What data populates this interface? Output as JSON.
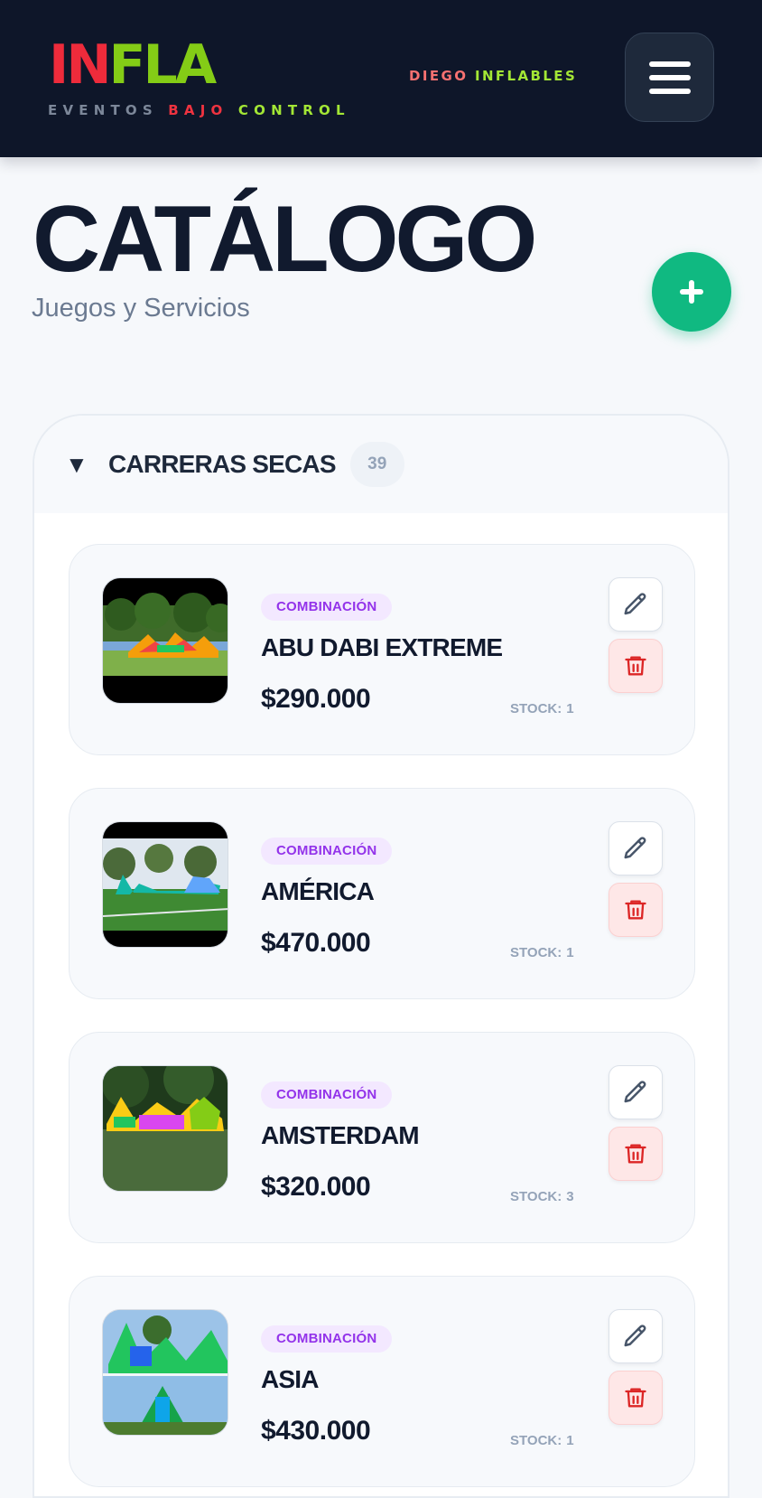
{
  "header": {
    "logo_in": "IN",
    "logo_fla": "FLA",
    "tagline_part1": "EVENTOS",
    "tagline_part2": "BAJO",
    "tagline_part3": "CONTROL",
    "user_first": "DIEGO",
    "user_second": "INFLABLES",
    "menu_icon": "hamburger-menu-icon"
  },
  "page": {
    "title": "CATÁLOGO",
    "subtitle": "Juegos y Servicios",
    "add_icon": "plus-icon"
  },
  "category": {
    "expand_icon": "▼",
    "name": "CARRERAS SECAS",
    "count": "39"
  },
  "stock_label": "STOCK:",
  "items": [
    {
      "badge": "COMBINACIÓN",
      "name": "ABU DABI EXTREME",
      "price": "$290.000",
      "stock": "1"
    },
    {
      "badge": "COMBINACIÓN",
      "name": "AMÉRICA",
      "price": "$470.000",
      "stock": "1"
    },
    {
      "badge": "COMBINACIÓN",
      "name": "AMSTERDAM",
      "price": "$320.000",
      "stock": "3"
    },
    {
      "badge": "COMBINACIÓN",
      "name": "ASIA",
      "price": "$430.000",
      "stock": "1"
    }
  ],
  "colors": {
    "header_bg": "#0e1629",
    "logo_red": "#ee2b3b",
    "logo_green": "#84cc16",
    "fab_green": "#10b981",
    "badge_purple": "#9333ea",
    "delete_red": "#dc2626"
  }
}
